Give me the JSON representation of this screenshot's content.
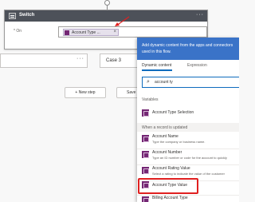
{
  "switch": {
    "title": "Switch",
    "more": "···",
    "on_label": "* On",
    "token_label": "Account Type ...",
    "token_remove": "×"
  },
  "cases": [
    {
      "label": "",
      "more": "···"
    },
    {
      "label": "Case 3",
      "more": ""
    }
  ],
  "buttons": {
    "new_step": "+ New step",
    "save": "Save"
  },
  "panel": {
    "header_text": "Add dynamic content from the apps and connectors used in this flow.",
    "tabs": [
      "Dynamic content",
      "Expression"
    ],
    "search_value": "account ty",
    "sections": {
      "variables": "Variables",
      "record_updated": "When a record is updated"
    },
    "items": [
      {
        "title": "Account Type Selection",
        "desc": ""
      },
      {
        "title": "Account Name",
        "desc": "Type the company or business name."
      },
      {
        "title": "Account Number",
        "desc": "Type an ID number or code for the account to quickly"
      },
      {
        "title": "Account Rating Value",
        "desc": "Select a rating to indicate the value of the customer"
      },
      {
        "title": "Account Type Value",
        "desc": ""
      },
      {
        "title": "Billing Account Type",
        "desc": ""
      }
    ]
  },
  "colors": {
    "header_blue": "#3a73c8",
    "switch_header": "#4d5159",
    "item_icon": "#742774",
    "highlight_red": "#e02020"
  }
}
